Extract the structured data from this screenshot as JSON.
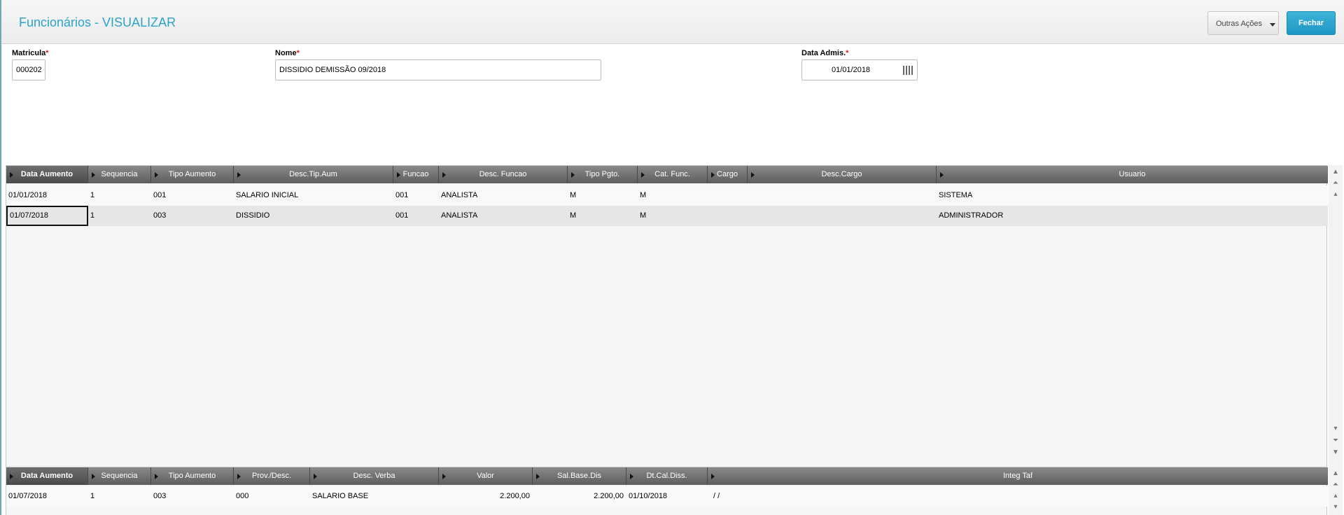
{
  "header": {
    "title": "Funcionários - VISUALIZAR",
    "other_actions_label": "Outras Ações",
    "close_label": "Fechar"
  },
  "form": {
    "matricula": {
      "label": "Matricula",
      "required": "*",
      "value": "000202"
    },
    "nome": {
      "label": "Nome",
      "required": "*",
      "value": "DISSIDIO DEMISSÃO 09/2018"
    },
    "data_admis": {
      "label": "Data Admis.",
      "required": "*",
      "value": "01/01/2018"
    }
  },
  "grid1": {
    "columns": [
      "Data Aumento",
      "Sequencia",
      "Tipo Aumento",
      "Desc.Tip.Aum",
      "Funcao",
      "Desc. Funcao",
      "Tipo Pgto.",
      "Cat. Func.",
      "Cargo",
      "Desc.Cargo",
      "Usuario"
    ],
    "rows": [
      [
        "01/01/2018",
        "1",
        "001",
        "SALARIO INICIAL",
        "001",
        "ANALISTA",
        "M",
        "M",
        "",
        "",
        "SISTEMA"
      ],
      [
        "01/07/2018",
        "1",
        "003",
        "DISSIDIO",
        "001",
        "ANALISTA",
        "M",
        "M",
        "",
        "",
        "ADMINISTRADOR"
      ]
    ]
  },
  "grid2": {
    "columns": [
      "Data Aumento",
      "Sequencia",
      "Tipo Aumento",
      "Prov./Desc.",
      "Desc. Verba",
      "Valor",
      "Sal.Base.Dis",
      "Dt.Cal.Diss.",
      "Integ Taf"
    ],
    "rows": [
      [
        "01/07/2018",
        "1",
        "003",
        "000",
        "SALARIO BASE",
        "2.200,00",
        "2.200,00",
        "01/10/2018",
        "/ /"
      ]
    ]
  },
  "colors": {
    "title": "#2aa3c9",
    "primary_button": "#2aa3c9",
    "required_marker": "#e01b1b",
    "grid_header": "#6a6a6a"
  }
}
